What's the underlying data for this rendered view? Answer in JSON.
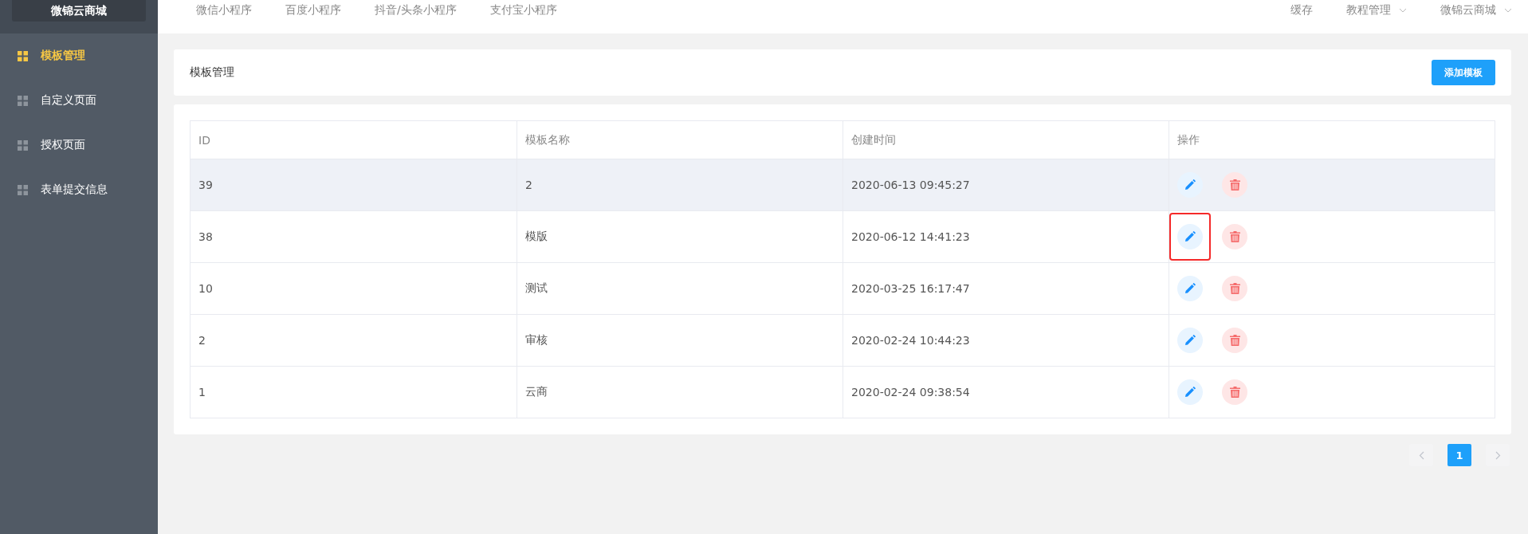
{
  "brand": "微锦云商城",
  "sidebar": {
    "items": [
      {
        "label": "模板管理",
        "selected": true
      },
      {
        "label": "自定义页面",
        "selected": false
      },
      {
        "label": "授权页面",
        "selected": false
      },
      {
        "label": "表单提交信息",
        "selected": false
      }
    ]
  },
  "top_nav": {
    "tabs": [
      {
        "label": "微信小程序"
      },
      {
        "label": "百度小程序"
      },
      {
        "label": "抖音/头条小程序"
      },
      {
        "label": "支付宝小程序"
      }
    ],
    "right": [
      {
        "label": "缓存",
        "kind": "link"
      },
      {
        "label": "教程管理",
        "kind": "dropdown"
      },
      {
        "label": "微锦云商城",
        "kind": "dropdown"
      }
    ]
  },
  "header": {
    "title": "模板管理",
    "add_button": "添加模板"
  },
  "table": {
    "columns": [
      "ID",
      "模板名称",
      "创建时间",
      "操作"
    ],
    "rows": [
      {
        "id": "39",
        "name": "2",
        "created": "2020-06-13 09:45:27",
        "hovered": true,
        "highlighted": false
      },
      {
        "id": "38",
        "name": "模版",
        "created": "2020-06-12 14:41:23",
        "hovered": false,
        "highlighted": true
      },
      {
        "id": "10",
        "name": "测试",
        "created": "2020-03-25 16:17:47",
        "hovered": false,
        "highlighted": false
      },
      {
        "id": "2",
        "name": "审核",
        "created": "2020-02-24 10:44:23",
        "hovered": false,
        "highlighted": false
      },
      {
        "id": "1",
        "name": "云商",
        "created": "2020-02-24 09:38:54",
        "hovered": false,
        "highlighted": false
      }
    ]
  },
  "pagination": {
    "pages": [
      {
        "label": "1",
        "selected": true
      }
    ]
  }
}
